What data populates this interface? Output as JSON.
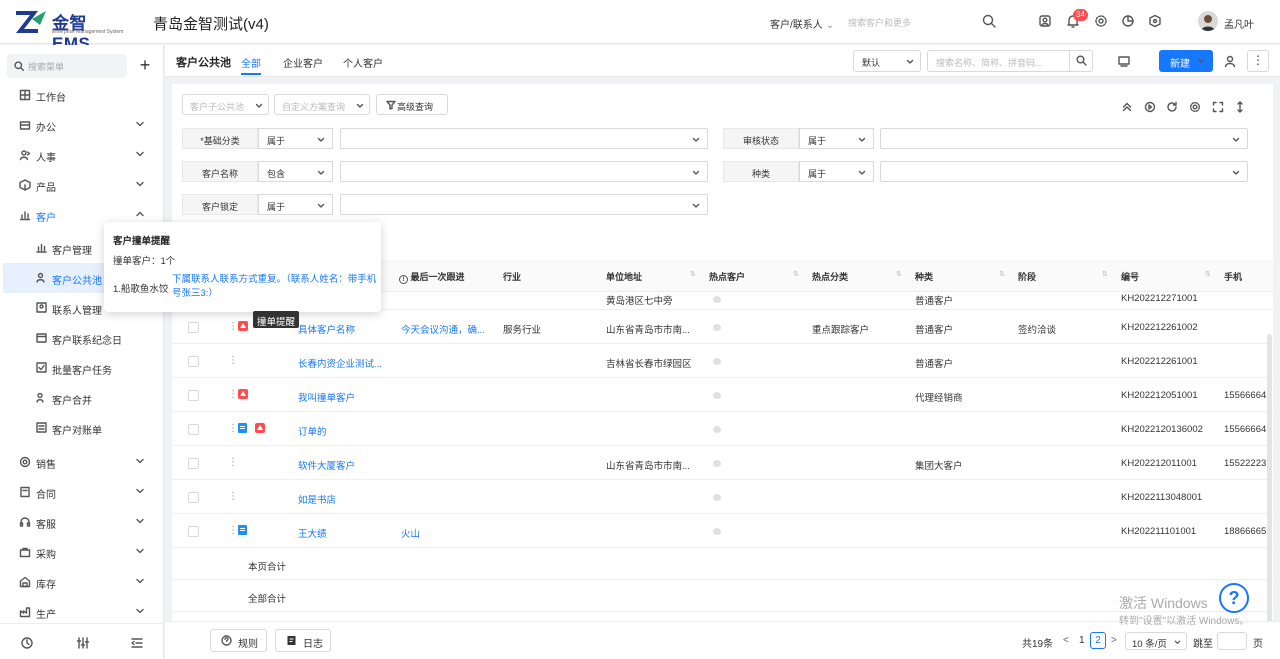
{
  "app": {
    "logo_text": "金智 EMS",
    "logo_subtitle": "Enterprise Management System",
    "title": "青岛金智测试(v4)"
  },
  "topbar": {
    "search_scope": "客户/联系人",
    "search_placeholder": "搜索客户和更多",
    "notification_count": "34",
    "user_name": "孟凡叶"
  },
  "sidebar": {
    "search_placeholder": "搜索菜单",
    "add_label": "+",
    "items": [
      {
        "label": "工作台"
      },
      {
        "label": "办公"
      },
      {
        "label": "人事"
      },
      {
        "label": "产品"
      },
      {
        "label": "客户"
      }
    ],
    "customer_sub": [
      {
        "label": "客户管理"
      },
      {
        "label": "客户公共池"
      },
      {
        "label": "联系人管理"
      },
      {
        "label": "客户联系纪念日"
      },
      {
        "label": "批量客户任务"
      },
      {
        "label": "客户合并"
      },
      {
        "label": "客户对账单"
      }
    ],
    "items_after": [
      {
        "label": "销售"
      },
      {
        "label": "合同"
      },
      {
        "label": "客服"
      },
      {
        "label": "采购"
      },
      {
        "label": "库存"
      },
      {
        "label": "生产"
      }
    ]
  },
  "content": {
    "page_title": "客户公共池",
    "tabs": [
      "全部",
      "企业客户",
      "个人客户"
    ],
    "view_select": "默认",
    "search_placeholder": "搜索名称、简称、拼音码...",
    "new_button": "新建"
  },
  "filters": {
    "sub_pool_placeholder": "客户子公共池",
    "scheme_placeholder": "自定义方案查询",
    "advanced_label": "高级查询",
    "rows": [
      {
        "label": "*基础分类",
        "op": "属于"
      },
      {
        "label": "审核状态",
        "op": "属于"
      },
      {
        "label": "客户名称",
        "op": "包含"
      },
      {
        "label": "种类",
        "op": "属于"
      },
      {
        "label": "客户锁定",
        "op": "属于"
      }
    ]
  },
  "table": {
    "headers": [
      "最后一次跟进",
      "行业",
      "单位地址",
      "热点客户",
      "热点分类",
      "种类",
      "阶段",
      "编号",
      "手机"
    ],
    "partial_row": {
      "address": "黄岛港区七中旁",
      "category": "普通客户",
      "code": "KH202212271001"
    },
    "rows": [
      {
        "name": "具体客户名称",
        "followup": "今天会议沟通，确...",
        "industry": "服务行业",
        "address": "山东省青岛市市南...",
        "hot_class": "重点跟踪客户",
        "category": "普通客户",
        "stage": "签约洽谈",
        "code": "KH202212261002",
        "phone": ""
      },
      {
        "name": "长春内资企业测试...",
        "followup": "",
        "industry": "",
        "address": "吉林省长春市绿园区",
        "hot_class": "",
        "category": "普通客户",
        "stage": "",
        "code": "KH202212261001",
        "phone": ""
      },
      {
        "name": "我叫撞单客户",
        "followup": "",
        "industry": "",
        "address": "",
        "hot_class": "",
        "category": "代理经销商",
        "stage": "",
        "code": "KH202212051001",
        "phone": "15566664"
      },
      {
        "name": "订单的",
        "followup": "",
        "industry": "",
        "address": "",
        "hot_class": "",
        "category": "",
        "stage": "",
        "code": "KH2022120136002",
        "phone": "15566664"
      },
      {
        "name": "软件大厦客户",
        "followup": "",
        "industry": "",
        "address": "山东省青岛市市南...",
        "hot_class": "",
        "category": "集团大客户",
        "stage": "",
        "code": "KH202212011001",
        "phone": "15522223"
      },
      {
        "name": "如是书店",
        "followup": "",
        "industry": "",
        "address": "",
        "hot_class": "",
        "category": "",
        "stage": "",
        "code": "KH2022113048001",
        "phone": ""
      },
      {
        "name": "王大绩",
        "followup": "火山",
        "industry": "",
        "address": "",
        "hot_class": "",
        "category": "",
        "stage": "",
        "code": "KH202211101001",
        "phone": "18866665"
      }
    ],
    "page_total_label": "本页合计",
    "all_total_label": "全部合计"
  },
  "popover": {
    "title": "客户撞单提醒",
    "count_text": "撞单客户：1个",
    "item": "1.船歌鱼水饺",
    "link": "下属联系人联系方式重复。（联系人姓名：带手机号张三3:）"
  },
  "tooltip": "撞单提醒",
  "footer": {
    "rules_label": "规则",
    "log_label": "日志",
    "total": "共19条",
    "prev": "<",
    "page1": "1",
    "current": "2",
    "next": ">",
    "page_size": "10 条/页",
    "jump_label": "跳至",
    "jump_unit": "页"
  },
  "watermark": {
    "line1": "激活 Windows",
    "line2": "转到\"设置\"以激活 Windows。"
  },
  "help_label": "?",
  "colors": {
    "primary": "#1677ff",
    "danger": "#ff4d4f",
    "brand": "#1f3a93"
  }
}
